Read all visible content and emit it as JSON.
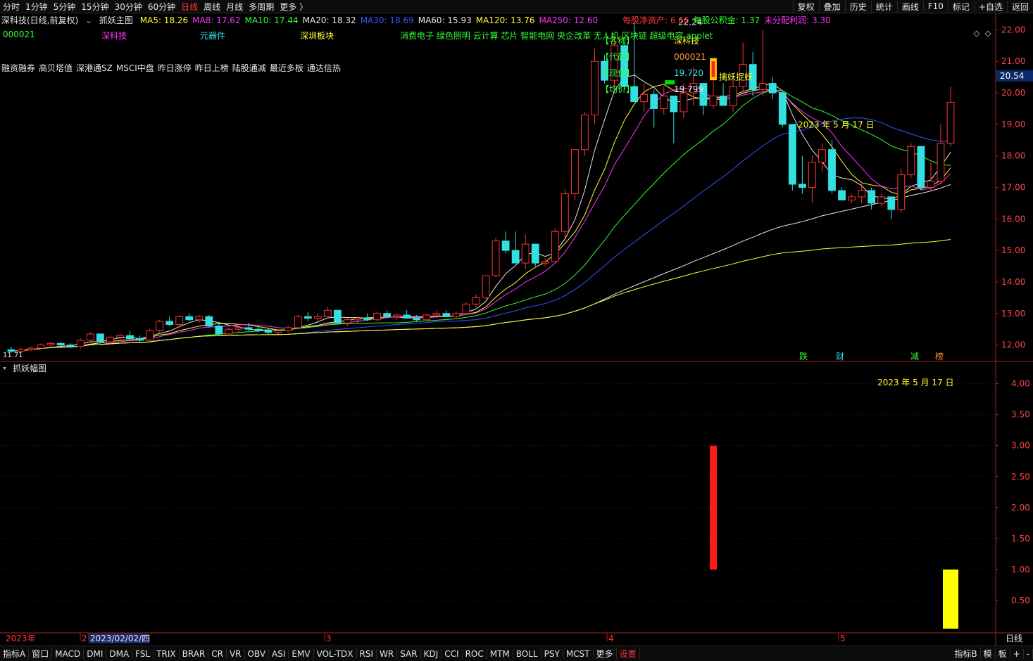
{
  "topbar": {
    "periods": [
      "分时",
      "1分钟",
      "5分钟",
      "15分钟",
      "30分钟",
      "60分钟",
      "日线",
      "周线",
      "月线",
      "多周期",
      "更多 〉"
    ],
    "active_period": "日线",
    "right_buttons": [
      "复权",
      "叠加",
      "历史",
      "统计",
      "画线",
      "F10",
      "标记",
      "+自选",
      "返回"
    ]
  },
  "header": {
    "stock_title": "深科技(日线,前复权)",
    "indicator_name": "抓妖主图",
    "ma": [
      {
        "label": "MA5: 18.26",
        "color": "#ffff33"
      },
      {
        "label": "MA8: 17.62",
        "color": "#ff33ff"
      },
      {
        "label": "MA10: 17.44",
        "color": "#33ff33"
      },
      {
        "label": "MA20: 18.32",
        "color": "#e6e6e6"
      },
      {
        "label": "MA30: 18.69",
        "color": "#3355ff"
      },
      {
        "label": "MA60: 15.93",
        "color": "#e6e6e6"
      },
      {
        "label": "MA120: 13.76",
        "color": "#ffff33"
      },
      {
        "label": "MA250: 12.60",
        "color": "#ff33ff"
      }
    ],
    "fundamentals": [
      {
        "label": "每股净资产: 6.66",
        "color": "#ff3333"
      },
      {
        "label": "每股公积金: 1.37",
        "color": "#33ff33"
      },
      {
        "label": "未分配利润: 3.30",
        "color": "#ff33ff"
      }
    ]
  },
  "info_line": {
    "code": "000021",
    "name": "深科技",
    "industry": "元器件",
    "region": "深圳板块",
    "concepts": "消费电子 绿色照明 云计算 芯片 智能电网 央企改革 无人机 区块链 超级电容 applet"
  },
  "tags": [
    "融资融券",
    "高贝塔值",
    "深港通SZ",
    "MSCI中盘",
    "昨日涨停",
    "昨日上榜",
    "陆股通减",
    "最近多板",
    "通达信热"
  ],
  "infobox": {
    "name_label": "【名称】",
    "name_value": "深科技",
    "code_label": "【代码】",
    "code_value": "000021",
    "price_label": "【现价】",
    "price_value": "19.720",
    "avg_label": "【均价】",
    "avg_value": "19.799",
    "high_label": "22.24"
  },
  "annotations": {
    "signal_text": "擒妖捉妖",
    "date_main": "2023 年 5 月 17 日",
    "date_sub": "2023 年 5 月 17 日",
    "low_label": "11.71"
  },
  "markers": [
    "跌",
    "财",
    "减",
    "榜"
  ],
  "price_axis": {
    "ticks": [
      "22.00",
      "21.00",
      "20.00",
      "19.00",
      "18.00",
      "17.00",
      "16.00",
      "15.00",
      "14.00",
      "13.00",
      "12.00"
    ],
    "current_price": "20.54"
  },
  "sub_panel": {
    "title": "抓妖幅图",
    "ticks": [
      "4.00",
      "3.50",
      "3.00",
      "2.50",
      "2.00",
      "1.50",
      "1.00",
      "0.50"
    ]
  },
  "time_axis": {
    "labels": [
      "2023年",
      "2",
      "2023/02/02/四",
      "3",
      "4",
      "5"
    ],
    "right_label": "日线"
  },
  "bottombar": {
    "tabs": [
      "指标A",
      "窗口",
      "MACD",
      "DMI",
      "DMA",
      "FSL",
      "TRIX",
      "BRAR",
      "CR",
      "VR",
      "OBV",
      "ASI",
      "EMV",
      "VOL-TDX",
      "RSI",
      "WR",
      "SAR",
      "KDJ",
      "CCI",
      "ROC",
      "MTM",
      "BOLL",
      "PSY",
      "MCST",
      "更多",
      "设置"
    ],
    "right_tabs": [
      "指标B",
      "模",
      "板",
      "+",
      "-"
    ]
  },
  "colors": {
    "up": "#ff3333",
    "down": "#33e0e0",
    "axis": "#aa2222",
    "grid": "#3a0a0a"
  },
  "chart_data": {
    "type": "candlestick",
    "candles": [
      [
        11.85,
        11.95,
        11.75,
        11.8
      ],
      [
        11.8,
        11.9,
        11.75,
        11.85
      ],
      [
        11.85,
        11.95,
        11.8,
        11.9
      ],
      [
        11.9,
        12.05,
        11.85,
        12.0
      ],
      [
        12.0,
        12.1,
        11.95,
        12.05
      ],
      [
        12.05,
        12.1,
        11.95,
        12.0
      ],
      [
        12.0,
        12.05,
        11.9,
        11.95
      ],
      [
        11.95,
        12.2,
        11.9,
        12.15
      ],
      [
        12.15,
        12.4,
        12.1,
        12.35
      ],
      [
        12.35,
        12.3,
        12.05,
        12.1
      ],
      [
        12.1,
        12.3,
        12.05,
        12.25
      ],
      [
        12.25,
        12.35,
        12.15,
        12.3
      ],
      [
        12.3,
        12.45,
        12.2,
        12.2
      ],
      [
        12.2,
        12.3,
        12.1,
        12.15
      ],
      [
        12.15,
        12.5,
        12.1,
        12.45
      ],
      [
        12.45,
        12.8,
        12.4,
        12.75
      ],
      [
        12.75,
        12.9,
        12.6,
        12.65
      ],
      [
        12.65,
        12.95,
        12.6,
        12.9
      ],
      [
        12.9,
        13.0,
        12.75,
        12.8
      ],
      [
        12.8,
        12.95,
        12.7,
        12.9
      ],
      [
        12.9,
        12.95,
        12.55,
        12.6
      ],
      [
        12.6,
        12.7,
        12.3,
        12.35
      ],
      [
        12.35,
        12.55,
        12.3,
        12.5
      ],
      [
        12.5,
        12.6,
        12.4,
        12.55
      ],
      [
        12.55,
        12.7,
        12.45,
        12.5
      ],
      [
        12.5,
        12.6,
        12.4,
        12.45
      ],
      [
        12.45,
        12.55,
        12.35,
        12.4
      ],
      [
        12.4,
        12.5,
        12.35,
        12.45
      ],
      [
        12.45,
        12.6,
        12.4,
        12.55
      ],
      [
        12.55,
        12.95,
        12.5,
        12.9
      ],
      [
        12.9,
        13.05,
        12.75,
        12.85
      ],
      [
        12.85,
        13.0,
        12.75,
        12.9
      ],
      [
        12.9,
        13.2,
        12.85,
        13.1
      ],
      [
        13.1,
        13.0,
        12.65,
        12.7
      ],
      [
        12.7,
        12.85,
        12.6,
        12.8
      ],
      [
        12.8,
        12.9,
        12.7,
        12.85
      ],
      [
        12.85,
        13.0,
        12.75,
        12.8
      ],
      [
        12.8,
        13.05,
        12.75,
        13.0
      ],
      [
        13.0,
        13.1,
        12.85,
        12.9
      ],
      [
        12.9,
        13.0,
        12.8,
        12.95
      ],
      [
        12.95,
        13.1,
        12.85,
        12.85
      ],
      [
        12.85,
        12.95,
        12.75,
        12.8
      ],
      [
        12.8,
        13.0,
        12.75,
        12.95
      ],
      [
        12.95,
        13.1,
        12.9,
        13.0
      ],
      [
        13.0,
        13.1,
        12.9,
        12.9
      ],
      [
        12.9,
        13.05,
        12.85,
        13.0
      ],
      [
        13.0,
        13.35,
        12.95,
        13.3
      ],
      [
        13.3,
        13.6,
        13.2,
        13.5
      ],
      [
        13.5,
        14.2,
        13.45,
        14.2
      ],
      [
        14.2,
        15.4,
        14.15,
        15.3
      ],
      [
        15.3,
        15.6,
        14.9,
        15.0
      ],
      [
        15.0,
        15.6,
        14.7,
        14.6
      ],
      [
        14.6,
        15.5,
        14.4,
        15.2
      ],
      [
        15.2,
        15.0,
        14.5,
        14.6
      ],
      [
        14.6,
        14.75,
        14.5,
        14.65
      ],
      [
        14.65,
        15.7,
        14.6,
        15.6
      ],
      [
        15.6,
        16.95,
        15.3,
        16.8
      ],
      [
        16.8,
        17.25,
        16.6,
        18.2
      ],
      [
        18.2,
        19.4,
        18.0,
        19.3
      ],
      [
        19.3,
        21.4,
        19.0,
        21.0
      ],
      [
        21.0,
        21.2,
        20.3,
        20.4
      ],
      [
        20.4,
        21.8,
        20.1,
        21.5
      ],
      [
        21.5,
        21.6,
        20.1,
        20.2
      ],
      [
        20.2,
        22.24,
        19.8,
        19.72
      ],
      [
        19.72,
        20.3,
        19.4,
        19.95
      ],
      [
        19.95,
        20.1,
        18.9,
        19.5
      ],
      [
        19.5,
        20.2,
        19.3,
        19.9
      ],
      [
        19.9,
        19.7,
        18.4,
        19.4
      ],
      [
        19.4,
        20.3,
        19.2,
        20.0
      ],
      [
        20.0,
        20.8,
        19.6,
        20.3
      ],
      [
        20.3,
        20.1,
        19.3,
        19.6
      ],
      [
        19.6,
        20.4,
        19.5,
        19.9
      ],
      [
        19.9,
        20.3,
        19.6,
        19.6
      ],
      [
        19.6,
        20.6,
        19.4,
        20.2
      ],
      [
        20.2,
        21.6,
        20.0,
        20.9
      ],
      [
        20.9,
        21.3,
        19.9,
        20.1
      ],
      [
        20.1,
        22.0,
        19.9,
        20.3
      ],
      [
        20.3,
        20.5,
        19.8,
        20.0
      ],
      [
        20.0,
        20.0,
        18.9,
        19.0
      ],
      [
        19.0,
        18.2,
        16.9,
        17.1
      ],
      [
        17.1,
        18.0,
        16.8,
        17.0
      ],
      [
        17.0,
        18.0,
        16.5,
        17.8
      ],
      [
        17.8,
        18.4,
        17.5,
        18.2
      ],
      [
        18.2,
        18.5,
        16.8,
        16.9
      ],
      [
        16.9,
        17.0,
        16.6,
        16.6
      ],
      [
        16.6,
        16.8,
        16.5,
        16.7
      ],
      [
        16.7,
        17.1,
        16.5,
        16.9
      ],
      [
        16.9,
        17.0,
        16.3,
        16.5
      ],
      [
        16.5,
        16.8,
        16.4,
        16.7
      ],
      [
        16.7,
        16.6,
        16.0,
        16.3
      ],
      [
        16.3,
        17.6,
        16.2,
        17.4
      ],
      [
        17.4,
        18.4,
        17.3,
        18.3
      ],
      [
        18.3,
        17.9,
        16.9,
        17.0
      ],
      [
        17.0,
        17.8,
        16.9,
        17.2
      ],
      [
        17.2,
        19.0,
        17.1,
        18.4
      ],
      [
        18.4,
        20.2,
        18.3,
        19.7
      ]
    ],
    "ma_series": [
      {
        "name": "MA5",
        "color": "#e6e6e6"
      },
      {
        "name": "MA8",
        "color": "#ffff33"
      },
      {
        "name": "MA10",
        "color": "#ff33ff"
      },
      {
        "name": "MA20",
        "color": "#33ff33"
      },
      {
        "name": "MA30",
        "color": "#3355ff"
      },
      {
        "name": "MA60",
        "color": "#e6e6e6"
      },
      {
        "name": "MA120",
        "color": "#ffff33"
      }
    ],
    "y_range": [
      11.5,
      22.5
    ],
    "sub_bars": [
      {
        "index": 71,
        "value": 3.0,
        "color": "#ff1a1a"
      },
      {
        "index": 95,
        "value": 1.0,
        "color": "#ffff00"
      }
    ],
    "sub_y_range": [
      0,
      4.2
    ]
  }
}
